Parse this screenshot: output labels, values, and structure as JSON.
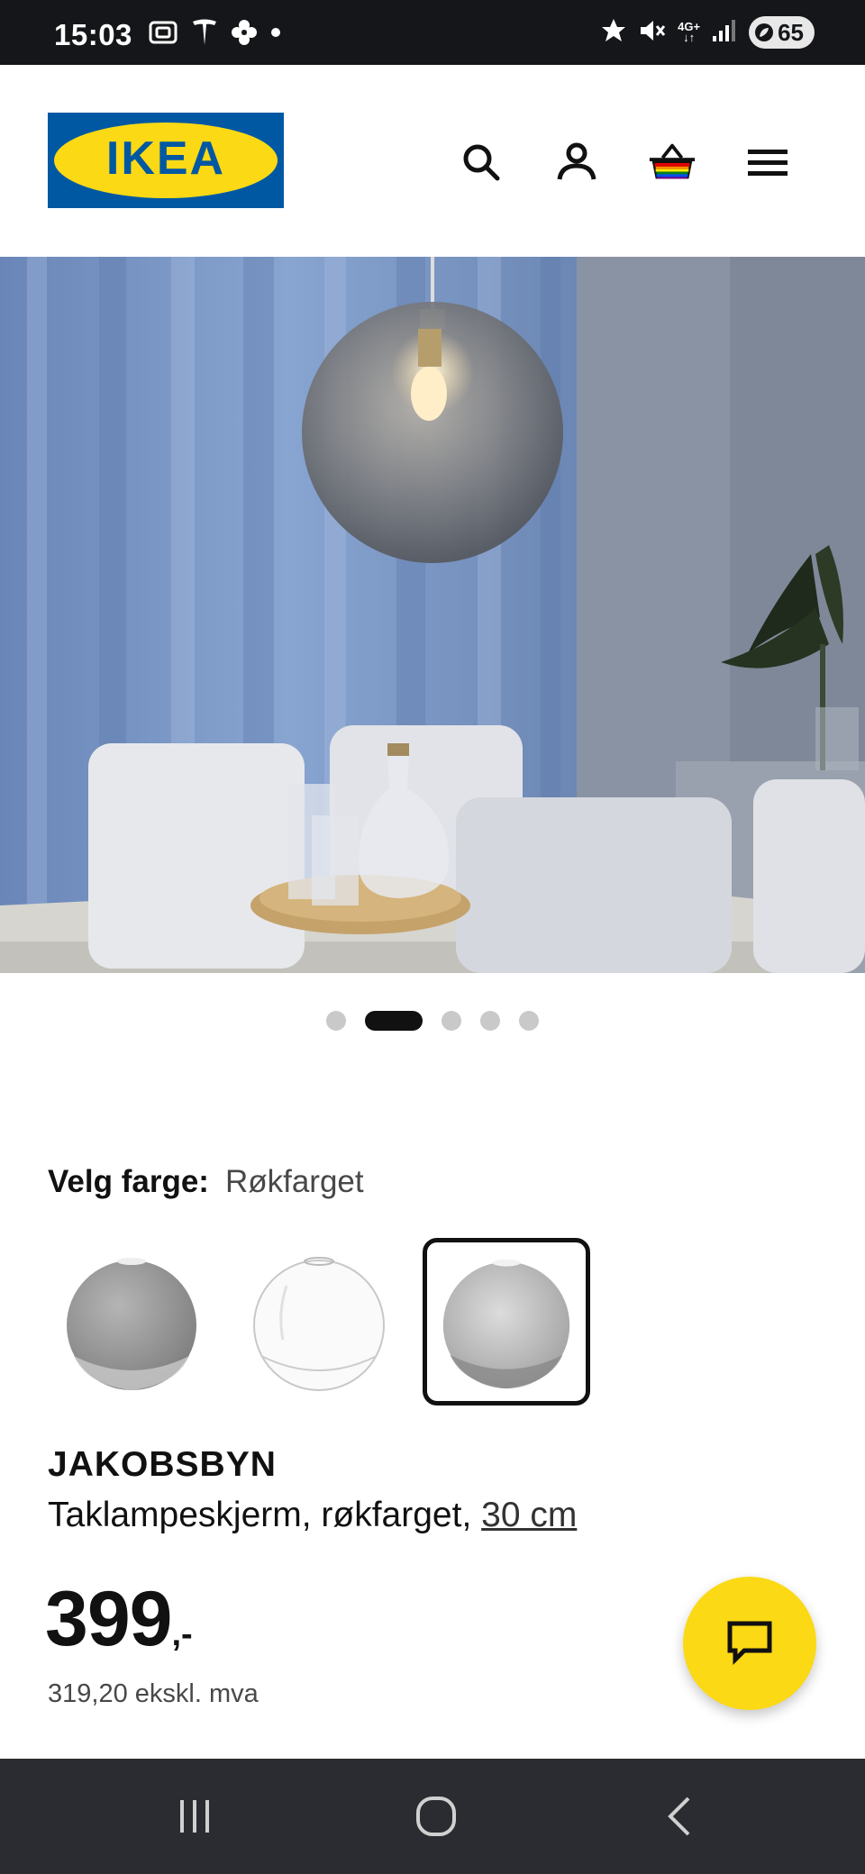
{
  "status_bar": {
    "time": "15:03",
    "network": "4G+",
    "battery": "65",
    "left_icons": [
      "screenshot-icon",
      "tesla-icon",
      "pinwheel-icon",
      "dot-icon"
    ],
    "right_icons": [
      "star-icon",
      "mute-icon",
      "network-4g-icon",
      "signal-icon",
      "battery-icon"
    ]
  },
  "header": {
    "logo_text": "IKEA",
    "brand_colors": {
      "blue": "#0058a3",
      "yellow": "#fbd914"
    },
    "icons": [
      "search-icon",
      "account-icon",
      "cart-icon",
      "menu-icon"
    ]
  },
  "gallery": {
    "image_count": 5,
    "active_index": 1
  },
  "color_select": {
    "label": "Velg farge:",
    "value": "Røkfarget",
    "options_count": 3,
    "selected_index": 2
  },
  "product": {
    "name": "JAKOBSBYN",
    "description": "Taklampeskjerm, røkfarget,",
    "size": "30 cm"
  },
  "price": {
    "amount": "399",
    "suffix": ",-",
    "ex_vat": "319,20 ekskl. mva"
  },
  "chat": {
    "icon": "chat-icon",
    "color": "#fbd914"
  },
  "nav_bar": {
    "icons": [
      "recents-icon",
      "home-icon",
      "back-icon"
    ]
  }
}
